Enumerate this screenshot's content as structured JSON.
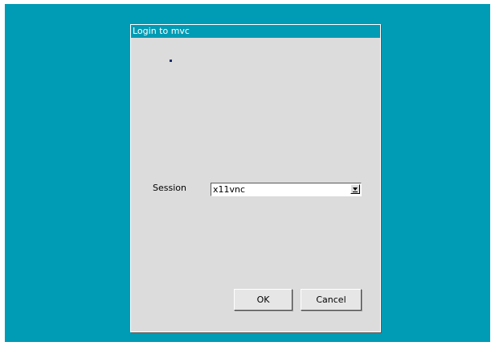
{
  "dialog": {
    "title": "Login to mvc",
    "session_label": "Session",
    "session_value": "x11vnc",
    "ok_label": "OK",
    "cancel_label": "Cancel"
  },
  "colors": {
    "desktop_background": "#009bb4",
    "dialog_background": "#dcdcdc",
    "titlebar_background": "#009bb4",
    "titlebar_text": "#ffffff"
  },
  "icons": {
    "dropdown": "dropdown-arrow-icon",
    "throbber": "throbber-dot-icon"
  }
}
